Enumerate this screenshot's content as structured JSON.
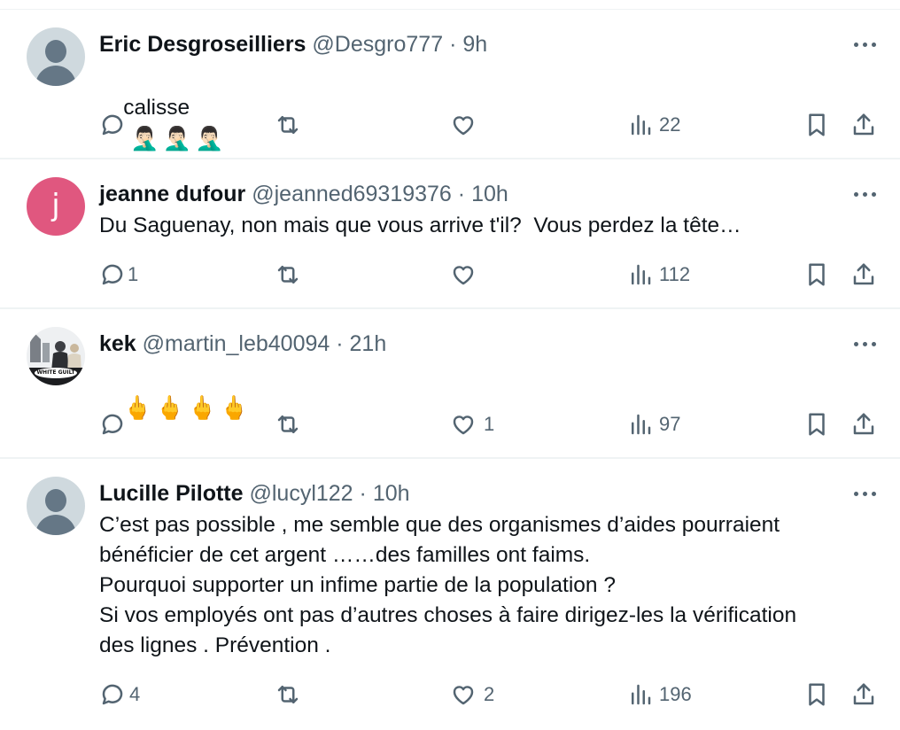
{
  "replies": [
    {
      "name": "Eric Desgroseilliers",
      "handle": "@Desgro777",
      "separator": "·",
      "time": "9h",
      "avatar": "default-avatar",
      "text": "calisse",
      "emojis": [
        "🤦🏻‍♂️",
        "🤦🏻‍♂️",
        "🤦🏻‍♂️"
      ],
      "replies_count": "",
      "retweets_count": "",
      "likes_count": "",
      "views_count": "22"
    },
    {
      "name": "jeanne dufour",
      "handle": "@jeanned69319376",
      "separator": "·",
      "time": "10h",
      "avatar": "letter-avatar",
      "avatar_letter": "j",
      "avatar_color": "#e0577f",
      "text": "Du Saguenay, non mais que vous arrive t'il?  Vous perdez la tête…",
      "emojis": [],
      "replies_count": "1",
      "retweets_count": "",
      "likes_count": "",
      "views_count": "112"
    },
    {
      "name": "kek",
      "handle": "@martin_leb40094",
      "separator": "·",
      "time": "21h",
      "avatar": "photo-avatar",
      "avatar_text": "WHITE GUILT",
      "text": "",
      "emojis": [
        "🖕",
        "🖕",
        "🖕",
        "🖕"
      ],
      "replies_count": "",
      "retweets_count": "",
      "likes_count": "1",
      "views_count": "97"
    },
    {
      "name": "Lucille Pilotte",
      "handle": "@lucyl122",
      "separator": "·",
      "time": "10h",
      "avatar": "default-avatar",
      "text": "C’est pas possible , me semble que des organismes d’aides pourraient\nbénéficier de cet argent ……des familles ont faims.\nPourquoi supporter un infime partie de la population ?\nSi vos employés ont pas d’autres choses à faire dirigez-les la vérification\ndes lignes . Prévention .",
      "emojis": [],
      "replies_count": "4",
      "retweets_count": "",
      "likes_count": "2",
      "views_count": "196"
    }
  ],
  "icons": {
    "more": "more-icon",
    "reply": "reply-icon",
    "retweet": "retweet-icon",
    "like": "like-icon",
    "views": "views-icon",
    "bookmark": "bookmark-icon",
    "share": "share-icon"
  },
  "colors": {
    "text": "#0f1419",
    "secondary": "#536471",
    "divider": "#eff3f4"
  }
}
